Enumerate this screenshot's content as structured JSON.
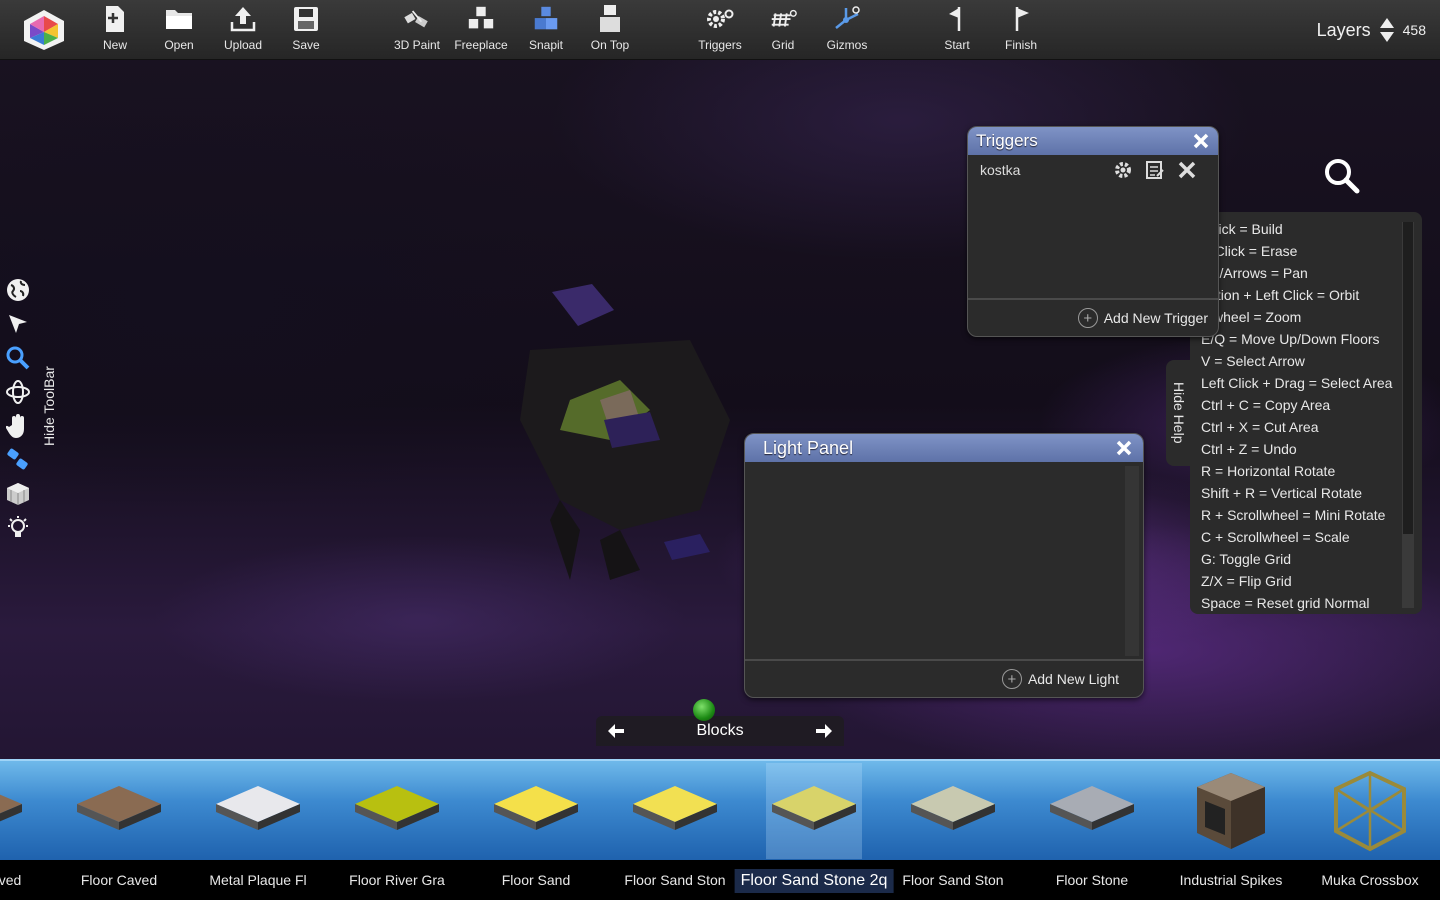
{
  "toolbar": {
    "buttons": [
      {
        "label": "New",
        "icon": "new-file-icon"
      },
      {
        "label": "Open",
        "icon": "folder-icon"
      },
      {
        "label": "Upload",
        "icon": "upload-icon"
      },
      {
        "label": "Save",
        "icon": "save-disk-icon"
      },
      {
        "label": "3D Paint",
        "icon": "paint-roller-icon"
      },
      {
        "label": "Freeplace",
        "icon": "cubes-icon"
      },
      {
        "label": "Snapit",
        "icon": "snap-cubes-icon"
      },
      {
        "label": "On Top",
        "icon": "stack-cube-icon"
      },
      {
        "label": "Triggers",
        "icon": "gears-icon"
      },
      {
        "label": "Grid",
        "icon": "grid-icon"
      },
      {
        "label": "Gizmos",
        "icon": "gizmo-icon"
      },
      {
        "label": "Start",
        "icon": "start-flag-icon"
      },
      {
        "label": "Finish",
        "icon": "finish-flag-icon"
      }
    ],
    "layers_label": "Layers",
    "layers_count": "458"
  },
  "left_toolbar": {
    "tools": [
      "globe-icon",
      "select-arrow-icon",
      "zoom-icon",
      "orbit-icon",
      "pan-hand-icon",
      "paint-icon",
      "block-icon",
      "light-bulb-icon"
    ],
    "hide_label": "Hide ToolBar"
  },
  "triggers_panel": {
    "title": "Triggers",
    "items": [
      {
        "name": "kostka"
      }
    ],
    "add_label": "Add New Trigger"
  },
  "light_panel": {
    "title": "Light Panel",
    "add_label": "Add New Light"
  },
  "help": {
    "hide_label": "Hide Help",
    "lines": [
      "Left Click = Build",
      "Right Click = Erase",
      "WASD/Arrows = Pan",
      "Alt/Option + Left Click = Orbit",
      "Scrollwheel = Zoom",
      "E/Q = Move Up/Down Floors",
      "V = Select Arrow",
      "Left Click + Drag = Select Area",
      "Ctrl + C = Copy Area",
      "Ctrl + X = Cut Area",
      "Ctrl + Z = Undo",
      "R = Horizontal Rotate",
      "Shift + R = Vertical Rotate",
      "R + Scrollwheel = Mini Rotate",
      "C + Scrollwheel = Scale",
      "G: Toggle Grid",
      "Z/X = Flip Grid",
      "Space = Reset grid Normal"
    ]
  },
  "blocks_nav": {
    "label": "Blocks"
  },
  "palette": {
    "items": [
      {
        "name": "Floor Caved",
        "color": "#8a6b52"
      },
      {
        "name": "Floor Caved",
        "color": "#8a6b52"
      },
      {
        "name": "Metal Plaque Fl",
        "color": "#e8e8ec"
      },
      {
        "name": "Floor River Gra",
        "color": "#b8c010"
      },
      {
        "name": "Floor Sand",
        "color": "#f4e04a"
      },
      {
        "name": "Floor Sand Ston",
        "color": "#f2e052"
      },
      {
        "name": "Floor Sand Stone 2q",
        "color": "#d8d36a"
      },
      {
        "name": "Floor Sand Ston",
        "color": "#c8c9b0"
      },
      {
        "name": "Floor Stone",
        "color": "#a8acb4"
      },
      {
        "name": "Industrial Spikes",
        "color": "#6b5a48"
      },
      {
        "name": "Muka Crossbox",
        "color": "#9a8a3a"
      }
    ],
    "visible_names": [
      "ved",
      "Floor Caved",
      "Metal Plaque Fl",
      "Floor River Gra",
      "Floor Sand",
      "Floor Sand Ston",
      "Floor Sand Stone 2q",
      "Floor Sand Ston",
      "Floor Stone",
      "Industrial Spikes",
      "Muka Crossbox"
    ],
    "selected_index": 6
  },
  "colors": {
    "panel_title": "#6f83b8",
    "palette_blue": "#3d8ad0"
  }
}
